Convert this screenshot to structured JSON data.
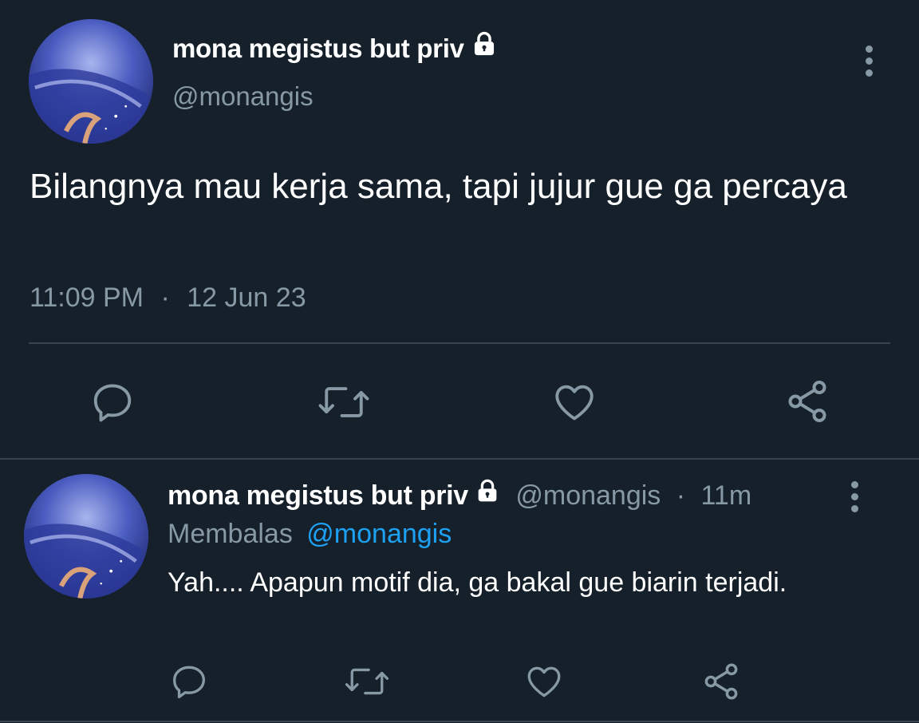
{
  "tweet": {
    "author_name": "mona megistus but priv",
    "author_handle": "@monangis",
    "text": "Bilangnya mau kerja sama, tapi jujur gue ga percaya",
    "time": "11:09 PM",
    "separator": "·",
    "date": "12 Jun 23",
    "icons": [
      "lock-icon",
      "more-options-icon",
      "reply-icon",
      "retweet-icon",
      "like-icon",
      "share-icon"
    ]
  },
  "reply": {
    "author_name": "mona megistus but priv",
    "author_handle": "@monangis",
    "separator": "·",
    "age": "11m",
    "replying_label": "Membalas",
    "replying_to": "@monangis",
    "text": "Yah.... Apapun motif dia, ga bakal gue biarin terjadi.",
    "icons": [
      "lock-icon",
      "more-options-icon",
      "reply-icon",
      "retweet-icon",
      "like-icon",
      "share-icon"
    ]
  },
  "colors": {
    "background": "#15202b",
    "text_primary": "#ffffff",
    "text_secondary": "#8899a6",
    "accent": "#1da1f2",
    "divider": "#38444d"
  }
}
